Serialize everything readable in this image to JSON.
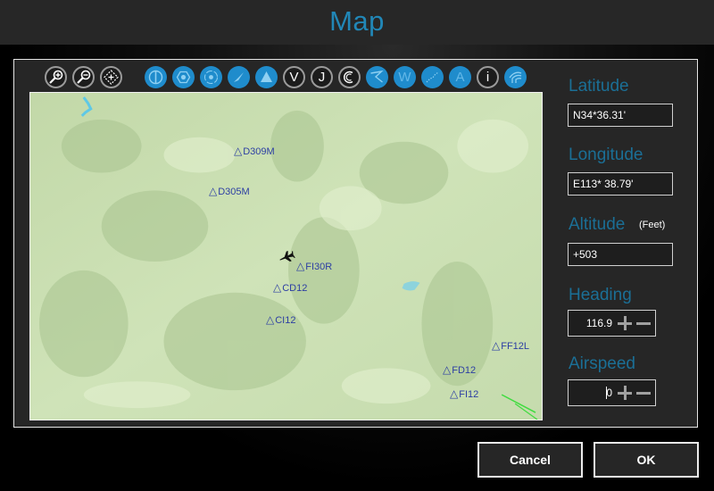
{
  "window": {
    "title": "Map"
  },
  "toolbar": {
    "buttons": [
      {
        "name": "zoom-in",
        "icon": "zoom-in-icon",
        "style": "outline"
      },
      {
        "name": "zoom-out",
        "icon": "zoom-out-icon",
        "style": "outline"
      },
      {
        "name": "center",
        "icon": "center-crosshair-icon",
        "style": "outline"
      },
      {
        "name": "vor-layer",
        "icon": "vor-icon",
        "style": "blue"
      },
      {
        "name": "ndb-layer",
        "icon": "ndb-hexagon-icon",
        "style": "blue"
      },
      {
        "name": "marker-layer",
        "icon": "marker-beacon-icon",
        "style": "blue"
      },
      {
        "name": "runway-layer",
        "icon": "runway-icon",
        "style": "blue"
      },
      {
        "name": "waypoint-layer",
        "icon": "triangle-icon",
        "style": "blue"
      },
      {
        "name": "victor-airways",
        "icon": "letter-v-icon",
        "style": "outline",
        "letter": "V"
      },
      {
        "name": "jet-airways",
        "icon": "letter-j-icon",
        "style": "outline",
        "letter": "J"
      },
      {
        "name": "holding-patterns",
        "icon": "holding-pattern-icon",
        "style": "outline"
      },
      {
        "name": "route-layer",
        "icon": "route-icon",
        "style": "blue"
      },
      {
        "name": "weather-layer",
        "icon": "letter-w-icon",
        "style": "blue",
        "letter": "W"
      },
      {
        "name": "track-layer",
        "icon": "track-icon",
        "style": "blue"
      },
      {
        "name": "airport-layer",
        "icon": "letter-a-icon",
        "style": "blue",
        "letter": "A"
      },
      {
        "name": "info",
        "icon": "info-icon",
        "style": "outline",
        "letter": "i"
      },
      {
        "name": "terrain-layer",
        "icon": "terrain-icon",
        "style": "blue"
      }
    ]
  },
  "map": {
    "waypoints": [
      {
        "label": "D309M"
      },
      {
        "label": "D305M"
      },
      {
        "label": "FI30R"
      },
      {
        "label": "CD12"
      },
      {
        "label": "CI12"
      },
      {
        "label": "FF12L"
      },
      {
        "label": "FD12"
      },
      {
        "label": "FI12"
      }
    ],
    "aircraft": {
      "icon": "aircraft-icon"
    },
    "colors": {
      "terrain": "#c7ddb0",
      "water": "#5ec8e6",
      "waypoint": "#2c3ea3",
      "route": "#3fdc3f"
    }
  },
  "fields": {
    "latitude": {
      "label": "Latitude",
      "value": "N34*36.31'"
    },
    "longitude": {
      "label": "Longitude",
      "value": "E113* 38.79'"
    },
    "altitude": {
      "label": "Altitude",
      "unit": "(Feet)",
      "value": "+503"
    },
    "heading": {
      "label": "Heading",
      "value": "116.9"
    },
    "airspeed": {
      "label": "Airspeed",
      "value": "0"
    }
  },
  "buttons": {
    "cancel": "Cancel",
    "ok": "OK"
  },
  "colors": {
    "accent": "#2187b7",
    "label": "#1b6f96",
    "toolbar_blue": "#1f8ccc"
  }
}
